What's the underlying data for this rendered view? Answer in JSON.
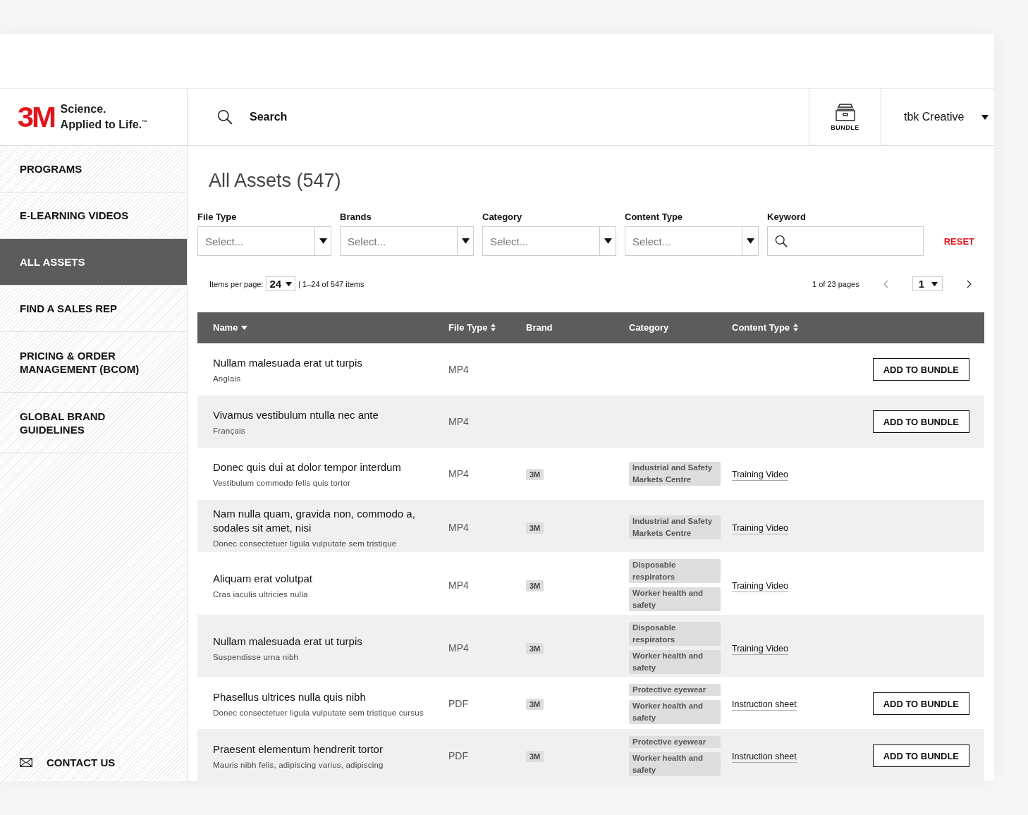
{
  "header": {
    "logo": {
      "mark": "3M",
      "tagline_1": "Science.",
      "tagline_2": "Applied to Life.",
      "trademark": "™"
    },
    "search": {
      "placeholder": "Search"
    },
    "bundle": {
      "label": "BUNDLE"
    },
    "user": {
      "name": "tbk Creative"
    }
  },
  "sidebar": {
    "items": [
      {
        "label": "PROGRAMS",
        "selected": false
      },
      {
        "label": "E-LEARNING VIDEOS",
        "selected": false
      },
      {
        "label": "ALL ASSETS",
        "selected": true
      },
      {
        "label": "FIND A SALES REP",
        "selected": false
      },
      {
        "label": "PRICING & ORDER MANAGEMENT (BCOM)",
        "selected": false
      },
      {
        "label": "GLOBAL BRAND GUIDELINES",
        "selected": false
      }
    ],
    "contact": {
      "label": "CONTACT US"
    }
  },
  "page": {
    "title": "All Assets (547)"
  },
  "filters": [
    {
      "kind": "select",
      "label": "File Type",
      "placeholder": "Select..."
    },
    {
      "kind": "select",
      "label": "Brands",
      "placeholder": "Select..."
    },
    {
      "kind": "select",
      "label": "Category",
      "placeholder": "Select..."
    },
    {
      "kind": "select",
      "label": "Content Type",
      "placeholder": "Select..."
    },
    {
      "kind": "search",
      "label": "Keyword"
    }
  ],
  "reset": {
    "label": "RESET"
  },
  "pagination": {
    "items_per_page_label": "Items per page:",
    "items_per_page": "24",
    "range": "| 1–24 of 547 items",
    "pages": "1 of 23 pages",
    "page": "1"
  },
  "table": {
    "columns": [
      {
        "label": "Name",
        "kind": "descending"
      },
      {
        "label": "File Type",
        "kind": "sortable"
      },
      {
        "label": "Brand",
        "kind": "plain"
      },
      {
        "label": "Category",
        "kind": "plain"
      },
      {
        "label": "Content Type",
        "kind": "sortable"
      }
    ],
    "rows": [
      {
        "name": "Nullam malesuada erat ut turpis",
        "subtitle": "Anglais",
        "file_type": "MP4",
        "action": "ADD TO BUNDLE"
      },
      {
        "name": "Vivamus vestibulum ntulla nec ante",
        "subtitle": "Français",
        "file_type": "MP4",
        "action": "ADD TO BUNDLE"
      },
      {
        "name": "Donec quis dui at dolor tempor interdum",
        "subtitle": "Vestibulum commodo felis quis tortor",
        "file_type": "MP4",
        "brand": "3M",
        "categories": [
          "Industrial and Safety Markets Centre"
        ],
        "content_type": "Training Video"
      },
      {
        "name": "Nam nulla quam, gravida non, commodo a, sodales sit amet, nisi",
        "subtitle": "Donec consectetuer ligula vulputate sem tristique",
        "file_type": "MP4",
        "brand": "3M",
        "categories": [
          "Industrial and Safety Markets Centre"
        ],
        "content_type": "Training Video"
      },
      {
        "name": "Aliquam erat volutpat",
        "subtitle": "Cras iaculis ultricies nulla",
        "file_type": "MP4",
        "brand": "3M",
        "categories": [
          "Disposable respirators",
          "Worker health and safety"
        ],
        "content_type": "Training Video"
      },
      {
        "name": "Nullam malesuada erat ut turpis",
        "subtitle": "Suspendisse urna nibh",
        "file_type": "MP4",
        "brand": "3M",
        "categories": [
          "Disposable respirators",
          "Worker health and safety"
        ],
        "content_type": "Training Video"
      },
      {
        "name": "Phasellus ultrices nulla quis nibh",
        "subtitle": "Donec consectetuer ligula vulputate sem tristique cursus",
        "file_type": "PDF",
        "brand": "3M",
        "categories": [
          "Protective eyewear",
          "Worker health and safety"
        ],
        "content_type": "Instruction sheet",
        "action": "ADD TO BUNDLE"
      },
      {
        "name": "Praesent elementum hendrerit tortor",
        "subtitle": "Mauris nibh felis, adipiscing varius, adipiscing",
        "file_type": "PDF",
        "brand": "3M",
        "categories": [
          "Protective eyewear",
          "Worker health and safety"
        ],
        "content_type": "Instruction sheet",
        "action": "ADD TO BUNDLE"
      }
    ]
  }
}
